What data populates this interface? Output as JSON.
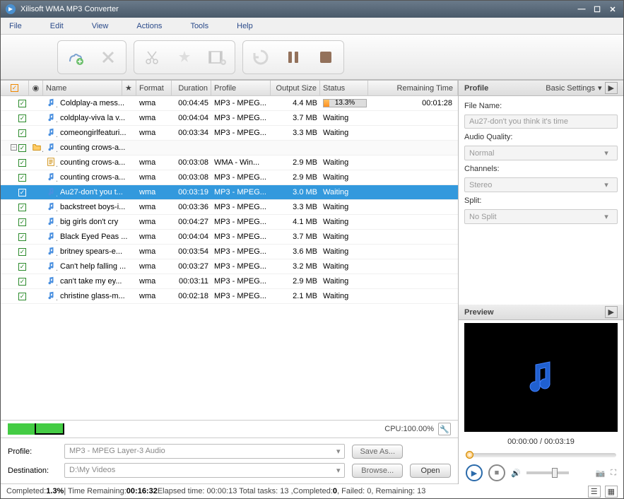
{
  "title": "Xilisoft WMA MP3 Converter",
  "menu": [
    "File",
    "Edit",
    "View",
    "Actions",
    "Tools",
    "Help"
  ],
  "columns": {
    "name": "Name",
    "format": "Format",
    "duration": "Duration",
    "profile": "Profile",
    "output": "Output Size",
    "status": "Status",
    "remaining": "Remaining Time"
  },
  "rows": [
    {
      "indent": 0,
      "type": "audio",
      "name": "Coldplay-a mess...",
      "format": "wma",
      "duration": "00:04:45",
      "profile": "MP3 - MPEG...",
      "size": "4.4 MB",
      "status": "progress",
      "statusVal": "13.3%",
      "remaining": "00:01:28"
    },
    {
      "indent": 0,
      "type": "audio",
      "name": "coldplay-viva la v...",
      "format": "wma",
      "duration": "00:04:04",
      "profile": "MP3 - MPEG...",
      "size": "3.7 MB",
      "status": "Waiting",
      "remaining": ""
    },
    {
      "indent": 0,
      "type": "audio",
      "name": "comeongirlfeaturi...",
      "format": "wma",
      "duration": "00:03:34",
      "profile": "MP3 - MPEG...",
      "size": "3.3 MB",
      "status": "Waiting",
      "remaining": ""
    },
    {
      "indent": 0,
      "type": "folder",
      "name": "counting crows-a...",
      "format": "",
      "duration": "",
      "profile": "",
      "size": "",
      "status": "",
      "remaining": ""
    },
    {
      "indent": 1,
      "type": "doc",
      "name": "counting crows-a...",
      "format": "wma",
      "duration": "00:03:08",
      "profile": "WMA - Win...",
      "size": "2.9 MB",
      "status": "Waiting",
      "remaining": ""
    },
    {
      "indent": 1,
      "type": "audio",
      "name": "counting crows-a...",
      "format": "wma",
      "duration": "00:03:08",
      "profile": "MP3 - MPEG...",
      "size": "2.9 MB",
      "status": "Waiting",
      "remaining": ""
    },
    {
      "indent": 0,
      "type": "audio",
      "selected": true,
      "name": "Au27-don't you t...",
      "format": "wma",
      "duration": "00:03:19",
      "profile": "MP3 - MPEG...",
      "size": "3.0 MB",
      "status": "Waiting",
      "remaining": ""
    },
    {
      "indent": 0,
      "type": "audio",
      "name": "backstreet boys-i...",
      "format": "wma",
      "duration": "00:03:36",
      "profile": "MP3 - MPEG...",
      "size": "3.3 MB",
      "status": "Waiting",
      "remaining": ""
    },
    {
      "indent": 0,
      "type": "audio",
      "name": "big girls don't cry",
      "format": "wma",
      "duration": "00:04:27",
      "profile": "MP3 - MPEG...",
      "size": "4.1 MB",
      "status": "Waiting",
      "remaining": ""
    },
    {
      "indent": 0,
      "type": "audio",
      "name": "Black Eyed Peas ...",
      "format": "wma",
      "duration": "00:04:04",
      "profile": "MP3 - MPEG...",
      "size": "3.7 MB",
      "status": "Waiting",
      "remaining": ""
    },
    {
      "indent": 0,
      "type": "audio",
      "name": "britney spears-e...",
      "format": "wma",
      "duration": "00:03:54",
      "profile": "MP3 - MPEG...",
      "size": "3.6 MB",
      "status": "Waiting",
      "remaining": ""
    },
    {
      "indent": 0,
      "type": "audio",
      "name": "Can't help falling ...",
      "format": "wma",
      "duration": "00:03:27",
      "profile": "MP3 - MPEG...",
      "size": "3.2 MB",
      "status": "Waiting",
      "remaining": ""
    },
    {
      "indent": 0,
      "type": "audio",
      "name": "can't take my ey...",
      "format": "wma",
      "duration": "00:03:11",
      "profile": "MP3 - MPEG...",
      "size": "2.9 MB",
      "status": "Waiting",
      "remaining": ""
    },
    {
      "indent": 0,
      "type": "audio",
      "name": "christine glass-m...",
      "format": "wma",
      "duration": "00:02:18",
      "profile": "MP3 - MPEG...",
      "size": "2.1 MB",
      "status": "Waiting",
      "remaining": ""
    }
  ],
  "sidebar": {
    "profile": "Profile",
    "basic": "Basic Settings",
    "filename_label": "File Name:",
    "filename_val": "Au27-don't you think it's time",
    "quality_label": "Audio Quality:",
    "quality_val": "Normal",
    "channels_label": "Channels:",
    "channels_val": "Stereo",
    "split_label": "Split:",
    "split_val": "No Split",
    "preview": "Preview",
    "time": "00:00:00 / 00:03:19"
  },
  "cpu": "CPU:100.00%",
  "bottom": {
    "profile_label": "Profile:",
    "profile_val": "MP3 - MPEG Layer-3 Audio",
    "saveas": "Save As...",
    "dest_label": "Destination:",
    "dest_val": "D:\\My Videos",
    "browse": "Browse...",
    "open": "Open"
  },
  "status": {
    "completed_l": "Completed: ",
    "completed_v": "1.3%",
    "remain_l": " | Time Remaining: ",
    "remain_v": "00:16:32",
    "elapsed": " Elapsed time: 00:00:13 Total tasks: 13 ,Completed: ",
    "c2": "0",
    "failed": ", Failed: 0, Remaining: 13"
  }
}
